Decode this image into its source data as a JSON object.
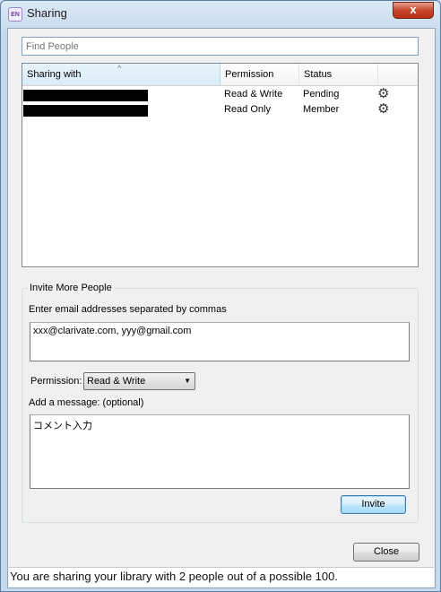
{
  "window": {
    "title": "Sharing",
    "app_icon_text": "EN",
    "close_glyph": "x"
  },
  "search": {
    "placeholder": "Find People",
    "value": ""
  },
  "share_list": {
    "columns": [
      "Sharing with",
      "Permission",
      "Status",
      ""
    ],
    "sort_indicator": "^",
    "rows": [
      {
        "name_redacted": true,
        "permission": "Read & Write",
        "status": "Pending",
        "action_icon": "gear-icon"
      },
      {
        "name_redacted": true,
        "permission": "Read Only",
        "status": "Member",
        "action_icon": "gear-icon"
      }
    ]
  },
  "invite": {
    "group_title": "Invite More People",
    "email_label": "Enter email addresses separated by commas",
    "email_value": "xxx@clarivate.com, yyy@gmail.com",
    "permission_label": "Permission:",
    "permission_value": "Read & Write",
    "message_label": "Add a message: (optional)",
    "message_value": "コメント入力",
    "invite_button": "Invite"
  },
  "close_button": "Close",
  "status_bar": "You are sharing your library with 2 people out of a possible 100.",
  "colors": {
    "title_bar": "#c6d9ec",
    "close_button_red": "#c7462c",
    "redaction": "#000000",
    "invite_button_border": "#3c7fb1"
  }
}
